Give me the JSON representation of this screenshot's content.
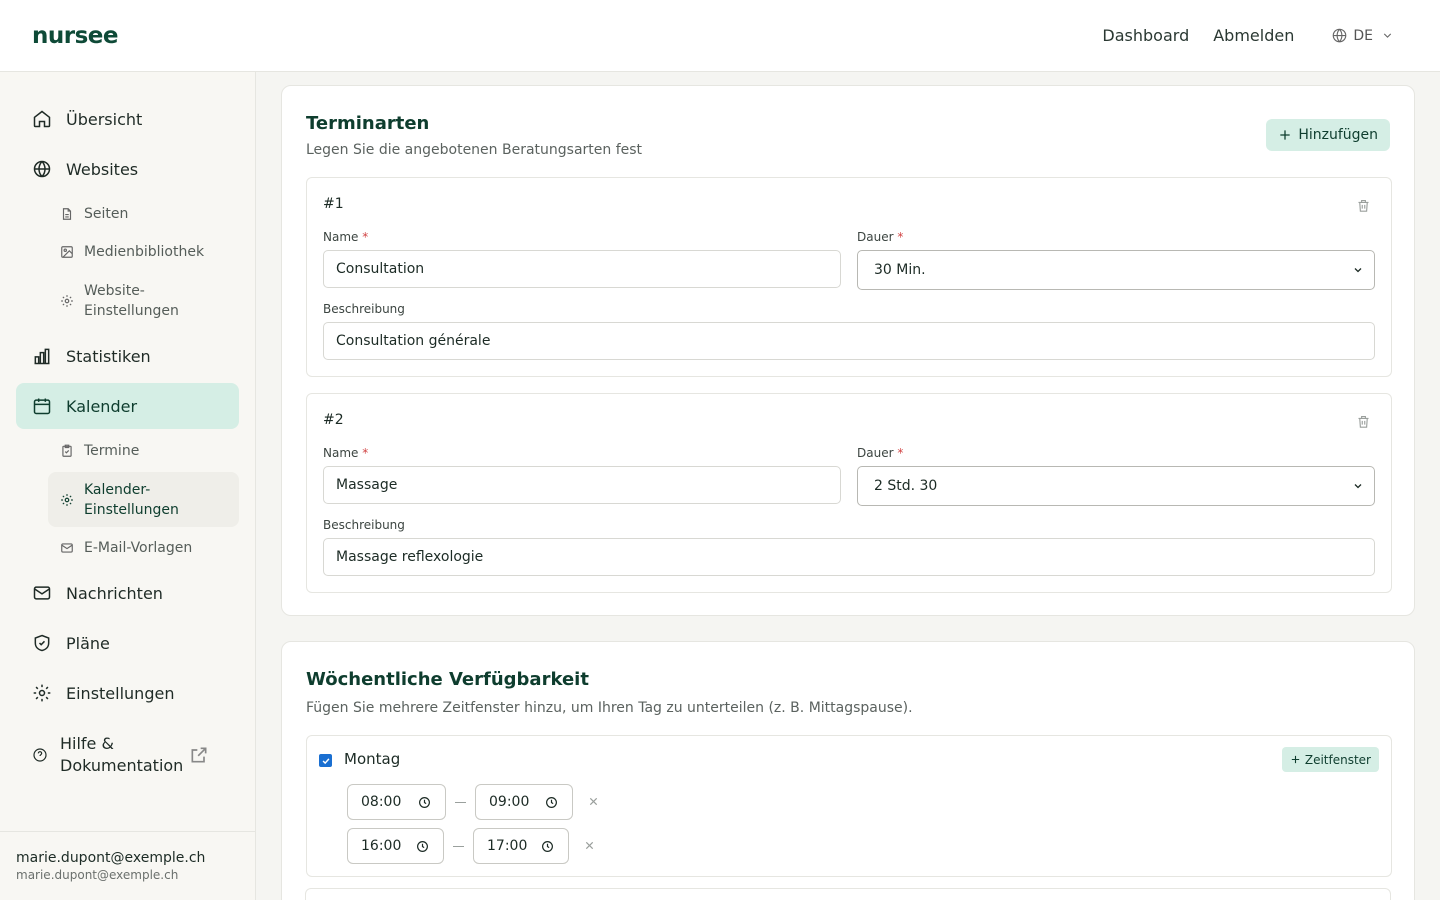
{
  "header": {
    "logo": "nursee",
    "nav": {
      "dashboard": "Dashboard",
      "logout": "Abmelden"
    },
    "language": "DE"
  },
  "sidebar": {
    "items": [
      {
        "label": "Übersicht",
        "icon": "home-icon"
      },
      {
        "label": "Websites",
        "icon": "globe-icon"
      },
      {
        "label": "Statistiken",
        "icon": "bar-chart-icon"
      },
      {
        "label": "Kalender",
        "icon": "calendar-icon",
        "active": true
      },
      {
        "label": "Nachrichten",
        "icon": "mail-icon"
      },
      {
        "label": "Pläne",
        "icon": "shield-icon"
      },
      {
        "label": "Einstellungen",
        "icon": "gear-icon"
      },
      {
        "label": "Hilfe & Dokumentation",
        "icon": "help-circle-icon"
      }
    ],
    "website_sub": [
      {
        "label": "Seiten",
        "icon": "file-icon"
      },
      {
        "label": "Medienbibliothek",
        "icon": "image-icon"
      },
      {
        "label": "Website-Einstellungen",
        "icon": "gear-icon"
      }
    ],
    "calendar_sub": [
      {
        "label": "Termine",
        "icon": "clipboard-icon"
      },
      {
        "label": "Kalender-Einstellungen",
        "icon": "gear-icon",
        "active": true
      },
      {
        "label": "E-Mail-Vorlagen",
        "icon": "mail-icon"
      }
    ],
    "user": {
      "name": "marie.dupont@exemple.ch",
      "email": "marie.dupont@exemple.ch"
    }
  },
  "appointment_types": {
    "title": "Terminarten",
    "subtitle": "Legen Sie die angebotenen Beratungsarten fest",
    "add_label": "Hinzufügen",
    "name_label": "Name",
    "duration_label": "Dauer",
    "description_label": "Beschreibung",
    "required_mark": "*",
    "items": [
      {
        "number": "#1",
        "name": "Consultation",
        "duration": "30 Min.",
        "description": "Consultation générale"
      },
      {
        "number": "#2",
        "name": "Massage",
        "duration": "2 Std. 30",
        "description": "Massage reflexologie"
      }
    ]
  },
  "availability": {
    "title": "Wöchentliche Verfügbarkeit",
    "subtitle": "Fügen Sie mehrere Zeitfenster hinzu, um Ihren Tag zu unterteilen (z. B. Mittagspause).",
    "slot_button": "Zeitfenster",
    "days": [
      {
        "name": "Montag",
        "checked": true,
        "slots": [
          {
            "start": "08:00",
            "end": "09:00"
          },
          {
            "start": "16:00",
            "end": "17:00"
          }
        ]
      }
    ]
  },
  "colors": {
    "brand": "#0e4a37",
    "accent_bg": "#d5eee5",
    "checkbox": "#1a6fd1",
    "required": "#d14343"
  }
}
